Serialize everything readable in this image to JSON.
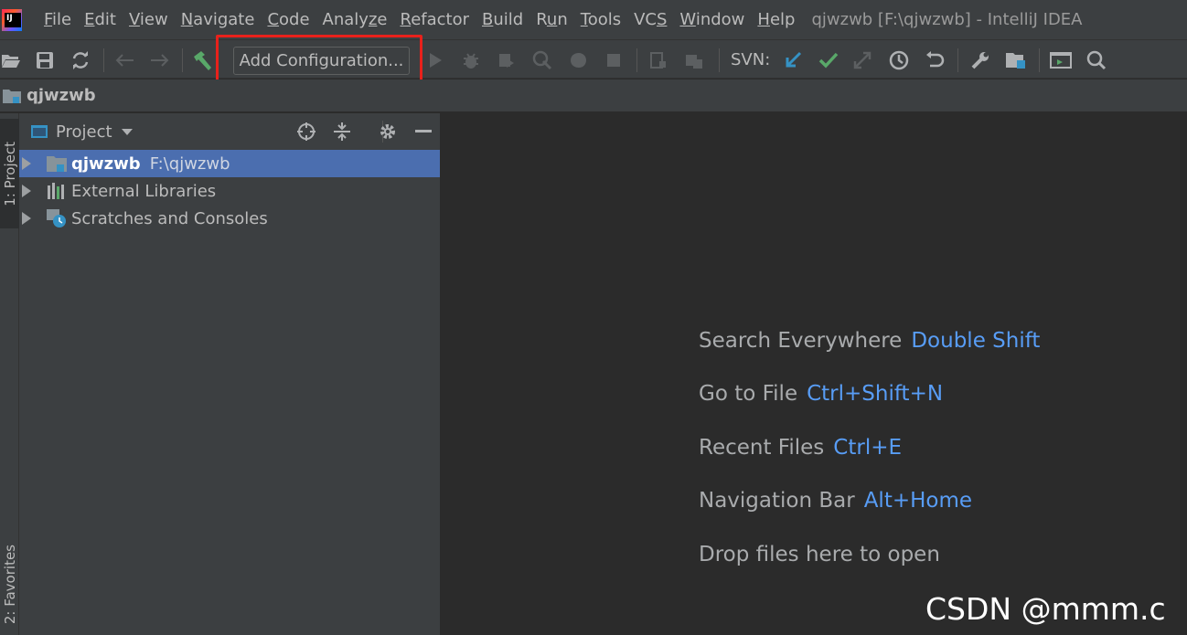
{
  "menu": {
    "items": [
      "File",
      "Edit",
      "View",
      "Navigate",
      "Code",
      "Analyze",
      "Refactor",
      "Build",
      "Run",
      "Tools",
      "VCS",
      "Window",
      "Help"
    ],
    "window_title": "qjwzwb [F:\\qjwzwb] - IntelliJ IDEA"
  },
  "toolbar": {
    "config_label": "Add Configuration...",
    "svn_label": "SVN:",
    "icons": [
      "open-folder-icon",
      "save-icon",
      "sync-icon",
      "back-arrow-icon",
      "forward-arrow-icon",
      "build-hammer-icon",
      "run-icon",
      "debug-icon",
      "coverage-icon",
      "profile-icon",
      "attach-icon",
      "stop-icon",
      "layout-icon",
      "package-icon",
      "svn-update-icon",
      "svn-commit-icon",
      "svn-compare-icon",
      "history-icon",
      "revert-icon",
      "settings-wrench-icon",
      "project-structure-icon",
      "terminal-icon",
      "search-icon"
    ]
  },
  "navbar": {
    "project_name": "qjwzwb"
  },
  "left_stripe": {
    "project_tab": "1: Project",
    "favorites_tab": "2: Favorites"
  },
  "project_panel": {
    "title": "Project",
    "tree": [
      {
        "label": "qjwzwb",
        "path": "F:\\qjwzwb",
        "selected": true
      },
      {
        "label": "External Libraries",
        "path": "",
        "selected": false
      },
      {
        "label": "Scratches and Consoles",
        "path": "",
        "selected": false
      }
    ]
  },
  "editor_hints": [
    {
      "text": "Search Everywhere",
      "key": "Double Shift"
    },
    {
      "text": "Go to File",
      "key": "Ctrl+Shift+N"
    },
    {
      "text": "Recent Files",
      "key": "Ctrl+E"
    },
    {
      "text": "Navigation Bar",
      "key": "Alt+Home"
    },
    {
      "text": "Drop files here to open",
      "key": ""
    }
  ],
  "watermark": "CSDN @mmm.c",
  "colors": {
    "accent_link": "#589df6",
    "selection": "#4b6eaf",
    "highlight_box": "#e8211b"
  }
}
